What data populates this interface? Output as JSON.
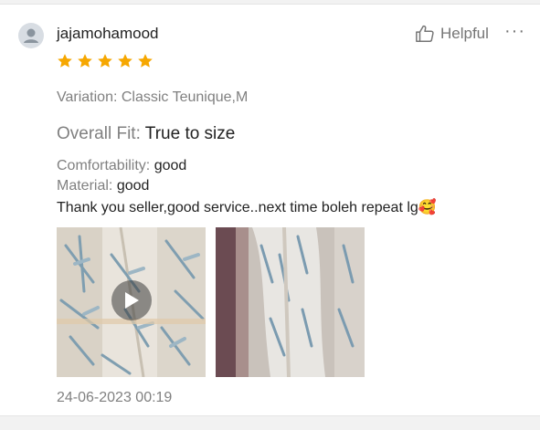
{
  "review": {
    "username": "jajamohamood",
    "rating": 5,
    "helpful_label": "Helpful",
    "more_label": "···",
    "variation": "Variation: Classic Teunique,M",
    "fit_label": "Overall Fit:",
    "fit_value": "True to size",
    "comfortability_label": "Comfortability:",
    "comfortability_value": "good",
    "material_label": "Material:",
    "material_value": "good",
    "comment": "Thank you seller,good service..next time boleh repeat lg🥰",
    "media": [
      {
        "kind": "video"
      },
      {
        "kind": "image"
      }
    ],
    "timestamp": "24-06-2023 00:19"
  },
  "colors": {
    "star": "#f6a700",
    "label_gray": "#808080",
    "text_dark": "#222222"
  }
}
